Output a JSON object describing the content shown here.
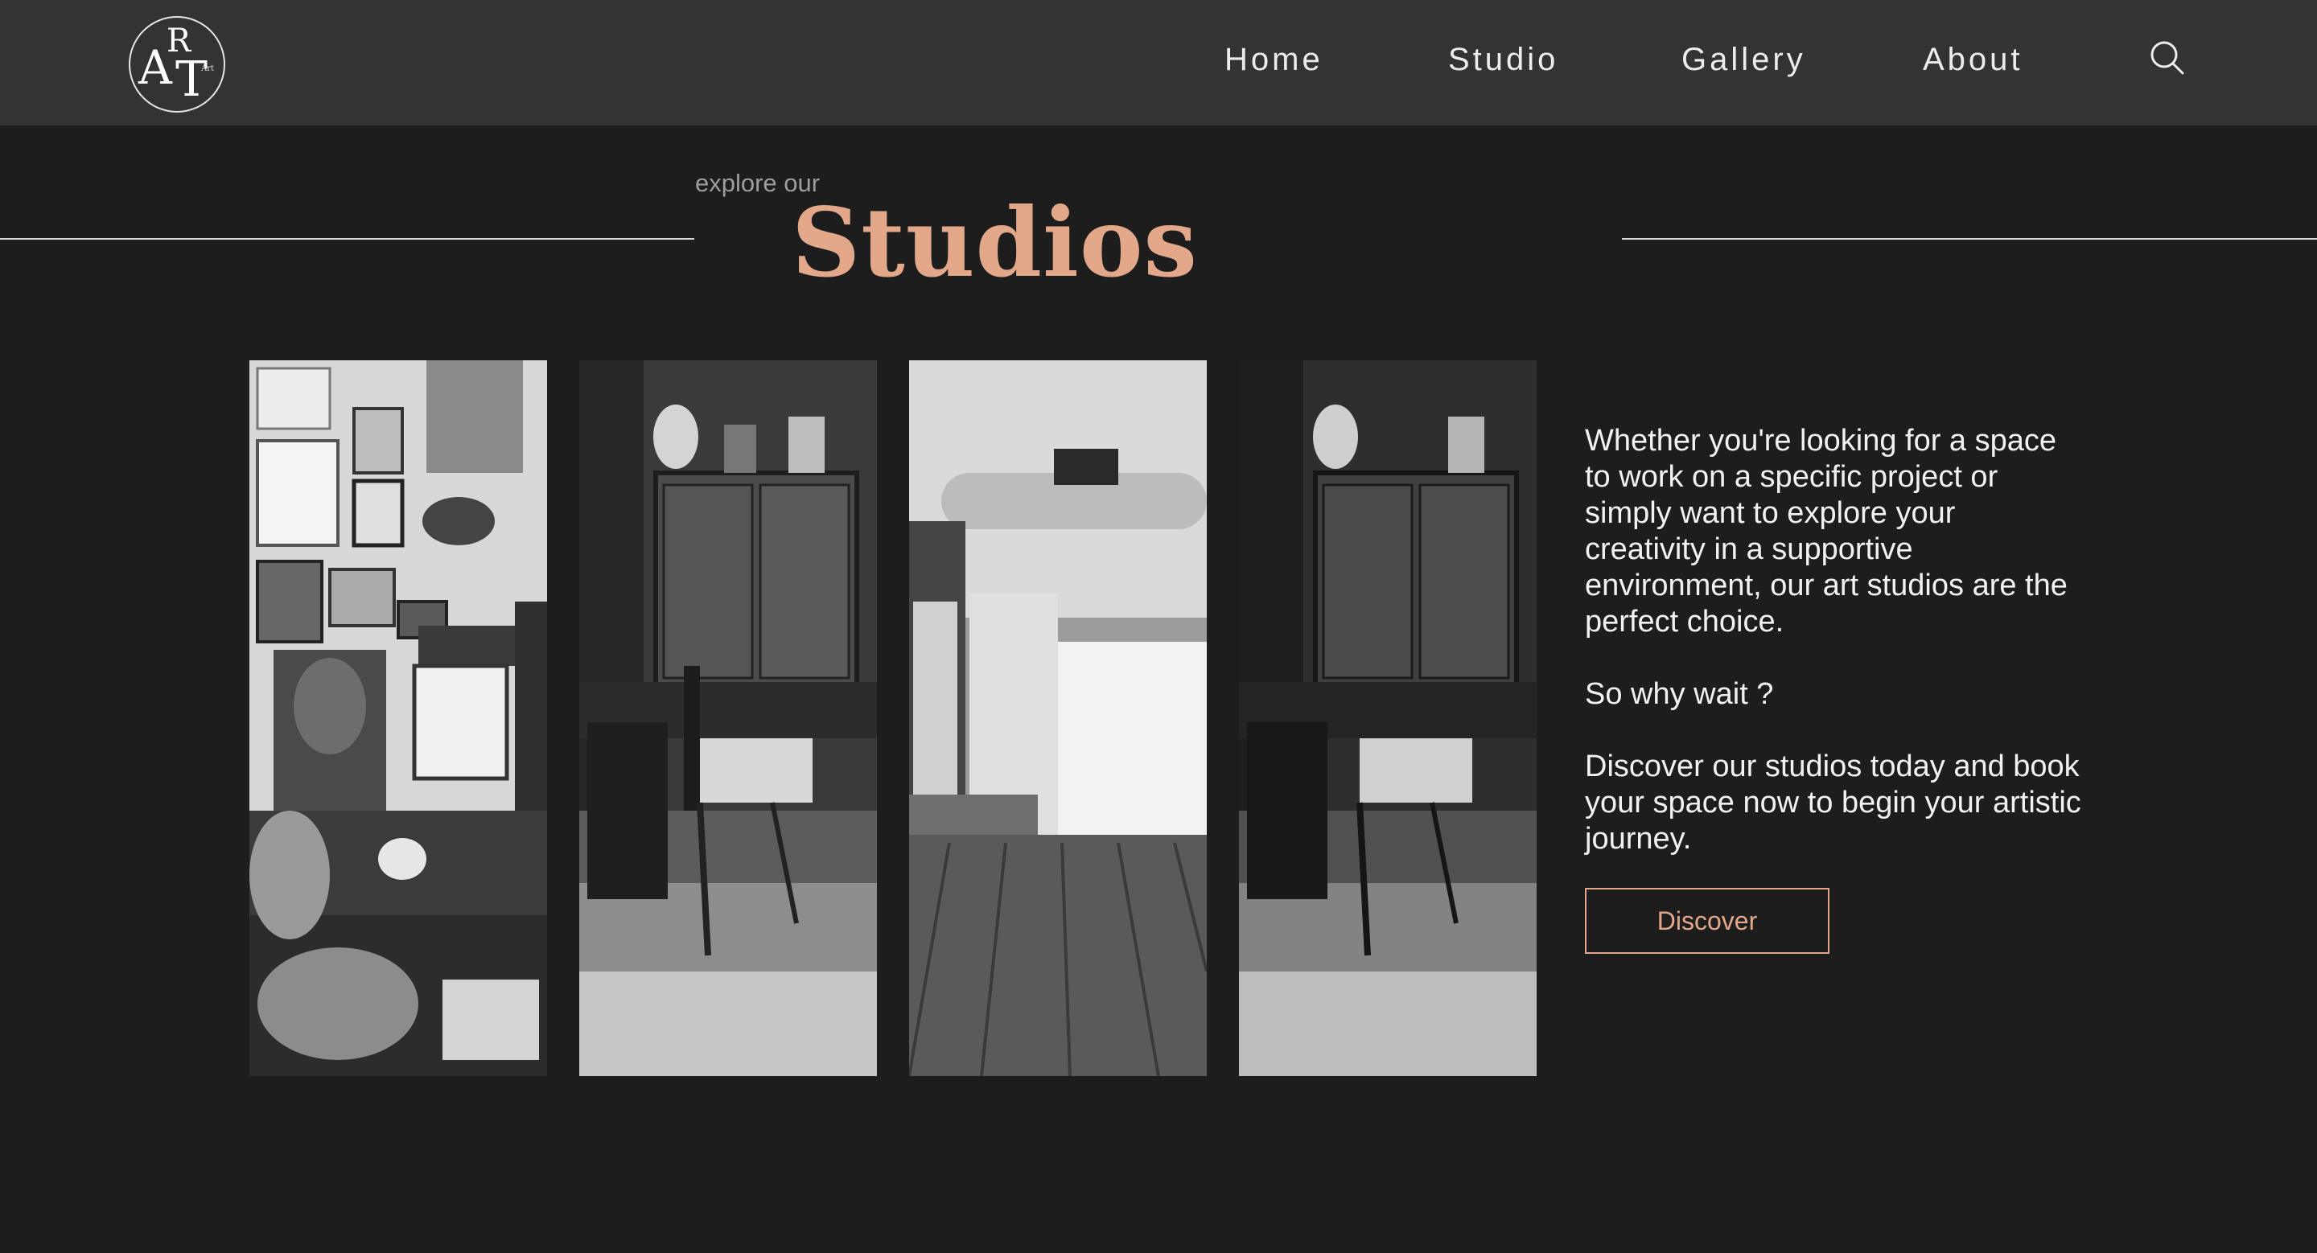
{
  "nav": {
    "logo": {
      "letter_a": "A",
      "letter_r": "R",
      "letter_t": "T",
      "small": "Art"
    },
    "items": [
      {
        "label": "Home"
      },
      {
        "label": "Studio"
      },
      {
        "label": "Gallery"
      },
      {
        "label": "About"
      }
    ],
    "search_icon": "search-icon"
  },
  "hero": {
    "kicker": "explore our",
    "title": "Studios"
  },
  "gallery": {
    "images": [
      {
        "name": "studio-photo-gallery-wall"
      },
      {
        "name": "studio-photo-cabinet-workspace"
      },
      {
        "name": "studio-photo-loft-backdrop"
      },
      {
        "name": "studio-photo-cabinet-workspace-dark"
      }
    ]
  },
  "content": {
    "paragraph1": "Whether you're looking for a space to work on a specific project or simply want to explore your creativity in a supportive environment, our art studios are the perfect choice.",
    "paragraph2": "So why wait ?",
    "paragraph3": "Discover our studios today and book your space now to begin your artistic journey.",
    "button_label": "Discover"
  },
  "colors": {
    "background": "#1d1d1d",
    "navbar": "#333333",
    "accent": "#e3a88a",
    "text": "#f2f2f2",
    "muted": "#9d9d9d"
  }
}
